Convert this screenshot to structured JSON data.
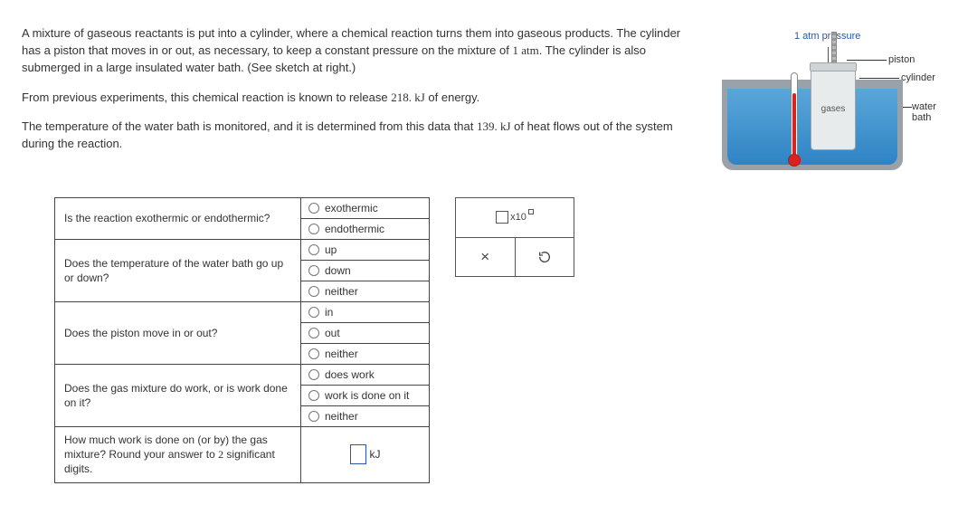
{
  "prompt": {
    "p1_a": "A mixture of gaseous reactants is put into a cylinder, where a chemical reaction turns them into gaseous products. The cylinder has a piston that moves in or out, as necessary, to keep a constant pressure on the mixture of ",
    "p1_atm": "1 atm",
    "p1_b": ". The cylinder is also submerged in a large insulated water bath. (See sketch at right.)",
    "p2_a": "From previous experiments, this chemical reaction is known to release ",
    "p2_val": "218. kJ",
    "p2_b": " of energy.",
    "p3_a": "The temperature of the water bath is monitored, and it is determined from this data that ",
    "p3_val": "139. kJ",
    "p3_b": " of heat flows out of the system during the reaction."
  },
  "sketch": {
    "atm": "1 atm pressure",
    "piston": "piston",
    "cylinder": "cylinder",
    "waterbath": "water bath",
    "gases": "gases"
  },
  "questions": {
    "q1": {
      "text": "Is the reaction exothermic or endothermic?",
      "opts": [
        "exothermic",
        "endothermic"
      ]
    },
    "q2": {
      "text": "Does the temperature of the water bath go up or down?",
      "opts": [
        "up",
        "down",
        "neither"
      ]
    },
    "q3": {
      "text": "Does the piston move in or out?",
      "opts": [
        "in",
        "out",
        "neither"
      ]
    },
    "q4": {
      "text": "Does the gas mixture do work, or is work done on it?",
      "opts": [
        "does work",
        "work is done on it",
        "neither"
      ]
    },
    "q5": {
      "text_a": "How much work is done on (or by) the gas mixture? Round your answer to ",
      "text_num": "2",
      "text_b": " significant digits.",
      "unit": "kJ"
    }
  },
  "toolbox": {
    "x10_sub": "x10",
    "close": "×"
  }
}
